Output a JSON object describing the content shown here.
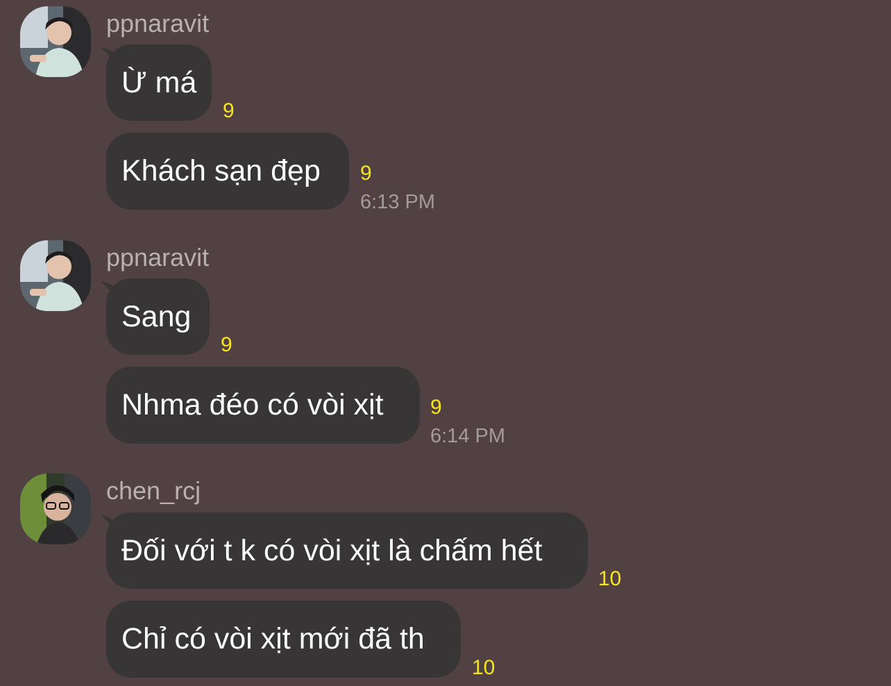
{
  "chat": {
    "groups": [
      {
        "sender": "ppnaravit",
        "avatar_icon": "user-avatar-photo",
        "messages": [
          {
            "text": "Ừ má",
            "count": "9"
          },
          {
            "text": "Khách sạn đẹp",
            "count": "9",
            "time": "6:13 PM"
          }
        ]
      },
      {
        "sender": "ppnaravit",
        "avatar_icon": "user-avatar-photo",
        "messages": [
          {
            "text": "Sang",
            "count": "9"
          },
          {
            "text": "Nhma đéo có vòi xịt",
            "count": "9",
            "time": "6:14 PM"
          }
        ]
      },
      {
        "sender": "chen_rcj",
        "avatar_icon": "user-avatar-photo",
        "messages": [
          {
            "text": "Đối với t k có vòi xịt là chấm hết",
            "count": "10"
          },
          {
            "text": "Chỉ có vòi xịt mới đã th",
            "count": "10"
          }
        ]
      }
    ]
  },
  "colors": {
    "background": "#524142",
    "bubble": "#373536",
    "count": "#f7e51e",
    "meta_text": "#b9b0b0"
  }
}
